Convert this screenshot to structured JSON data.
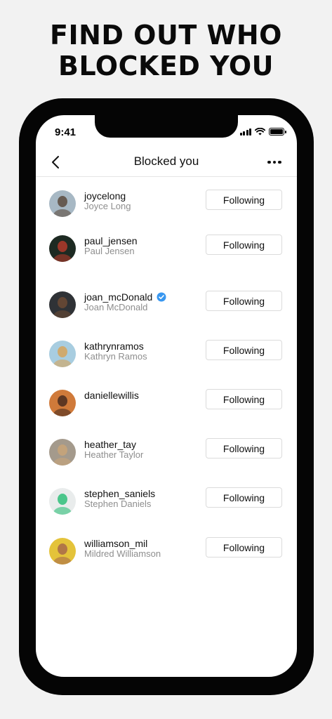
{
  "promo": {
    "line1": "FIND OUT WHO",
    "line2": "BLOCKED YOU"
  },
  "status_bar": {
    "time": "9:41"
  },
  "header": {
    "title": "Blocked you",
    "back_icon": "chevron-left-icon",
    "more_icon": "ellipsis-icon"
  },
  "users": [
    {
      "username": "joycelong",
      "full_name": "Joyce Long",
      "verified": false,
      "button": "Following",
      "avatar_color": "#a7b8c4",
      "avatar_fg": "#5a4a3e"
    },
    {
      "username": "paul_jensen",
      "full_name": "Paul Jensen",
      "verified": false,
      "button": "Following",
      "avatar_color": "#1d2a22",
      "avatar_fg": "#b23a2a"
    },
    {
      "username": "joan_mcDonald",
      "full_name": "Joan McDonald",
      "verified": true,
      "button": "Following",
      "avatar_color": "#2f3236",
      "avatar_fg": "#6b4a34"
    },
    {
      "username": "kathrynramos",
      "full_name": "Kathryn Ramos",
      "verified": false,
      "button": "Following",
      "avatar_color": "#a8cde0",
      "avatar_fg": "#d6a35a"
    },
    {
      "username": "daniellewillis",
      "full_name": "",
      "verified": false,
      "button": "Following",
      "avatar_color": "#d07a3a",
      "avatar_fg": "#4a2c1e"
    },
    {
      "username": "heather_tay",
      "full_name": "Heather Taylor",
      "verified": false,
      "button": "Following",
      "avatar_color": "#a49a8c",
      "avatar_fg": "#c9a578"
    },
    {
      "username": "stephen_saniels",
      "full_name": "Stephen Daniels",
      "verified": false,
      "button": "Following",
      "avatar_color": "#e9ecec",
      "avatar_fg": "#2fbf7a"
    },
    {
      "username": "williamson_mil",
      "full_name": "Mildred Williamson",
      "verified": false,
      "button": "Following",
      "avatar_color": "#e4c33a",
      "avatar_fg": "#a86a4a"
    }
  ],
  "colors": {
    "verified_badge": "#3897f0",
    "secondary_text": "#8e8e8e",
    "button_border": "#dbdbdb"
  }
}
